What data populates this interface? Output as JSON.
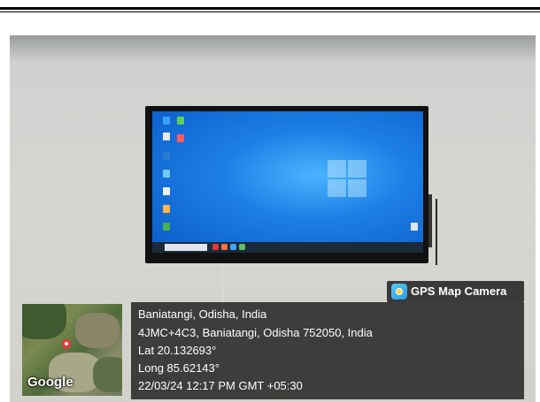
{
  "badge": {
    "label": "GPS Map Camera",
    "icon": "gps-map-camera-logo-icon"
  },
  "map": {
    "brand": "Google",
    "pin_icon": "location-pin-icon"
  },
  "location": {
    "place": "Baniatangi, Odisha, India",
    "address": "4JMC+4C3, Baniatangi, Odisha 752050, India",
    "lat": "Lat 20.132693°",
    "long": "Long 85.62143°",
    "datetime": "22/03/24 12:17 PM GMT +05:30"
  },
  "colors": {
    "panel": "#282828",
    "screen": "#1d7fe6",
    "pin": "#e53935"
  }
}
